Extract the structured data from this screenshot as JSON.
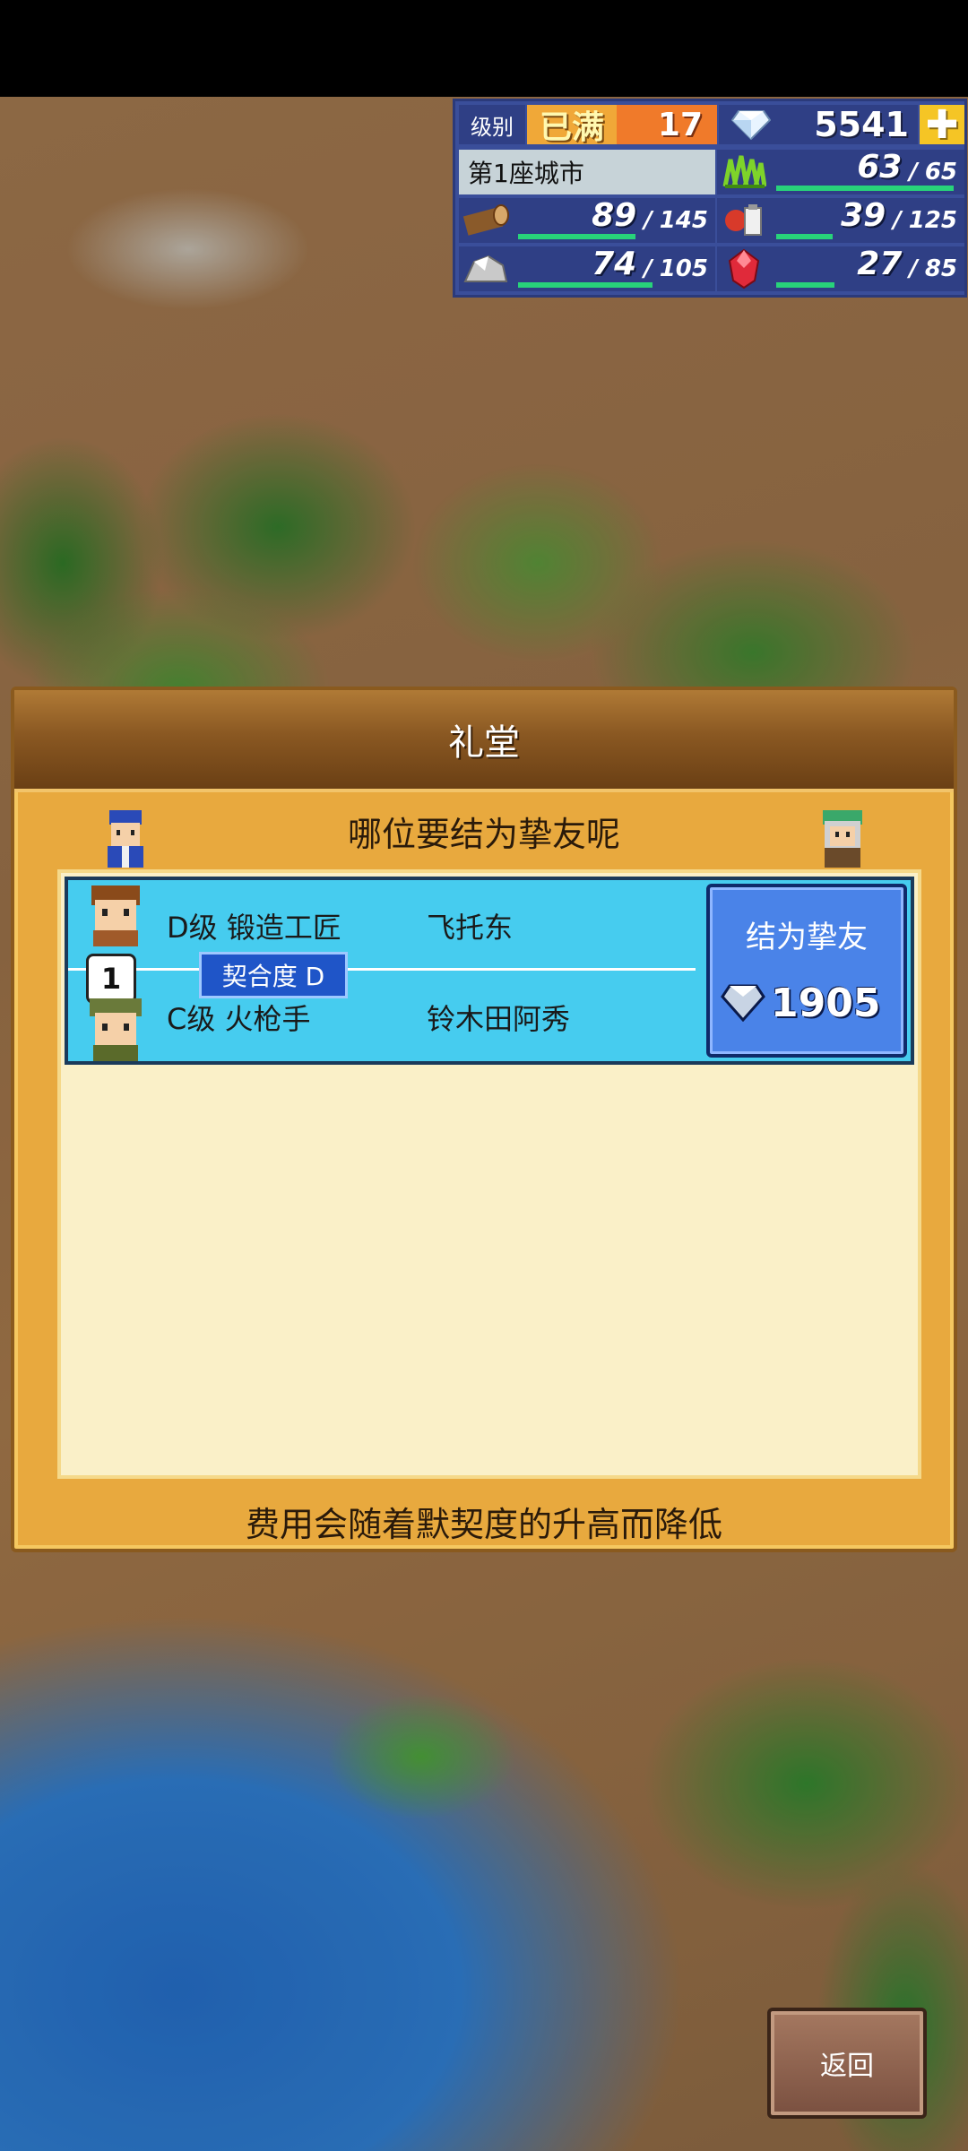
{
  "hud": {
    "level_label": "级别",
    "level_max": "已满",
    "level_value": "17",
    "gems": "5541",
    "plus_label": "✚",
    "city_name": "第1座城市",
    "resources": [
      {
        "icon": "grass-icon",
        "current": "63",
        "max": "65",
        "fill": 0.97
      },
      {
        "icon": "wood-log-icon",
        "current": "89",
        "max": "145",
        "fill": 0.61
      },
      {
        "icon": "food-icon",
        "current": "39",
        "max": "125",
        "fill": 0.31
      },
      {
        "icon": "ore-icon",
        "current": "74",
        "max": "105",
        "fill": 0.7
      },
      {
        "icon": "ruby-icon",
        "current": "27",
        "max": "85",
        "fill": 0.32
      }
    ],
    "separator": "/"
  },
  "dialog": {
    "title": "礼堂",
    "prompt": "哪位要结为挚友呢",
    "pair": {
      "number": "1",
      "top_char": {
        "rank_job": "D级 锻造工匠",
        "name": "飞托东"
      },
      "bottom_char": {
        "rank_job": "C级 火枪手",
        "name": "铃木田阿秀"
      },
      "affinity": "契合度 D",
      "action_label": "结为挚友",
      "cost": "1905"
    },
    "footer_note": "费用会随着默契度的升高而降低"
  },
  "back_label": "返回"
}
